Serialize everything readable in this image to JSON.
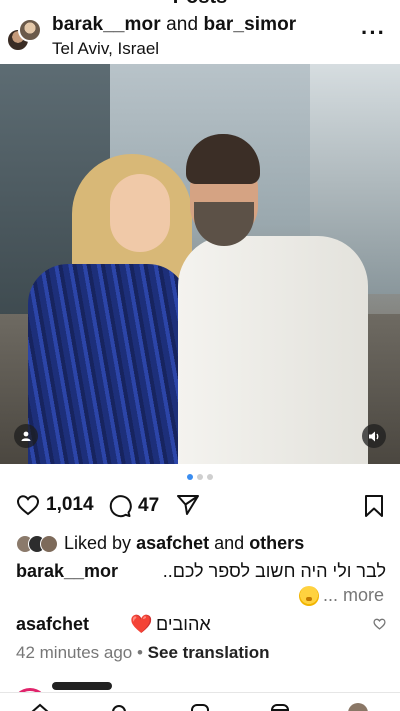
{
  "header": {
    "title": "Posts",
    "user1": "barak__mor",
    "and": "and",
    "user2": "bar_simor",
    "location": "Tel Aviv, Israel",
    "more_icon": "more-horizontal-icon"
  },
  "carousel": {
    "total": 3,
    "active": 1
  },
  "actions": {
    "likes": "1,014",
    "comments": "47"
  },
  "liked_by": {
    "prefix": "Liked by",
    "user": "asafchet",
    "and": "and",
    "others": "others"
  },
  "caption": {
    "user": "barak__mor",
    "text_line1": "לבר ולי היה חשוב לספר לכם..",
    "more": "... more"
  },
  "top_comment": {
    "user": "asafchet",
    "text": "אהובים"
  },
  "meta": {
    "time": "42 minutes ago",
    "separator": "•",
    "see_translation": "See translation"
  },
  "colors": {
    "accent_blue": "#3a8df0",
    "heart_red": "#e0245e",
    "muted_text": "#777777"
  }
}
